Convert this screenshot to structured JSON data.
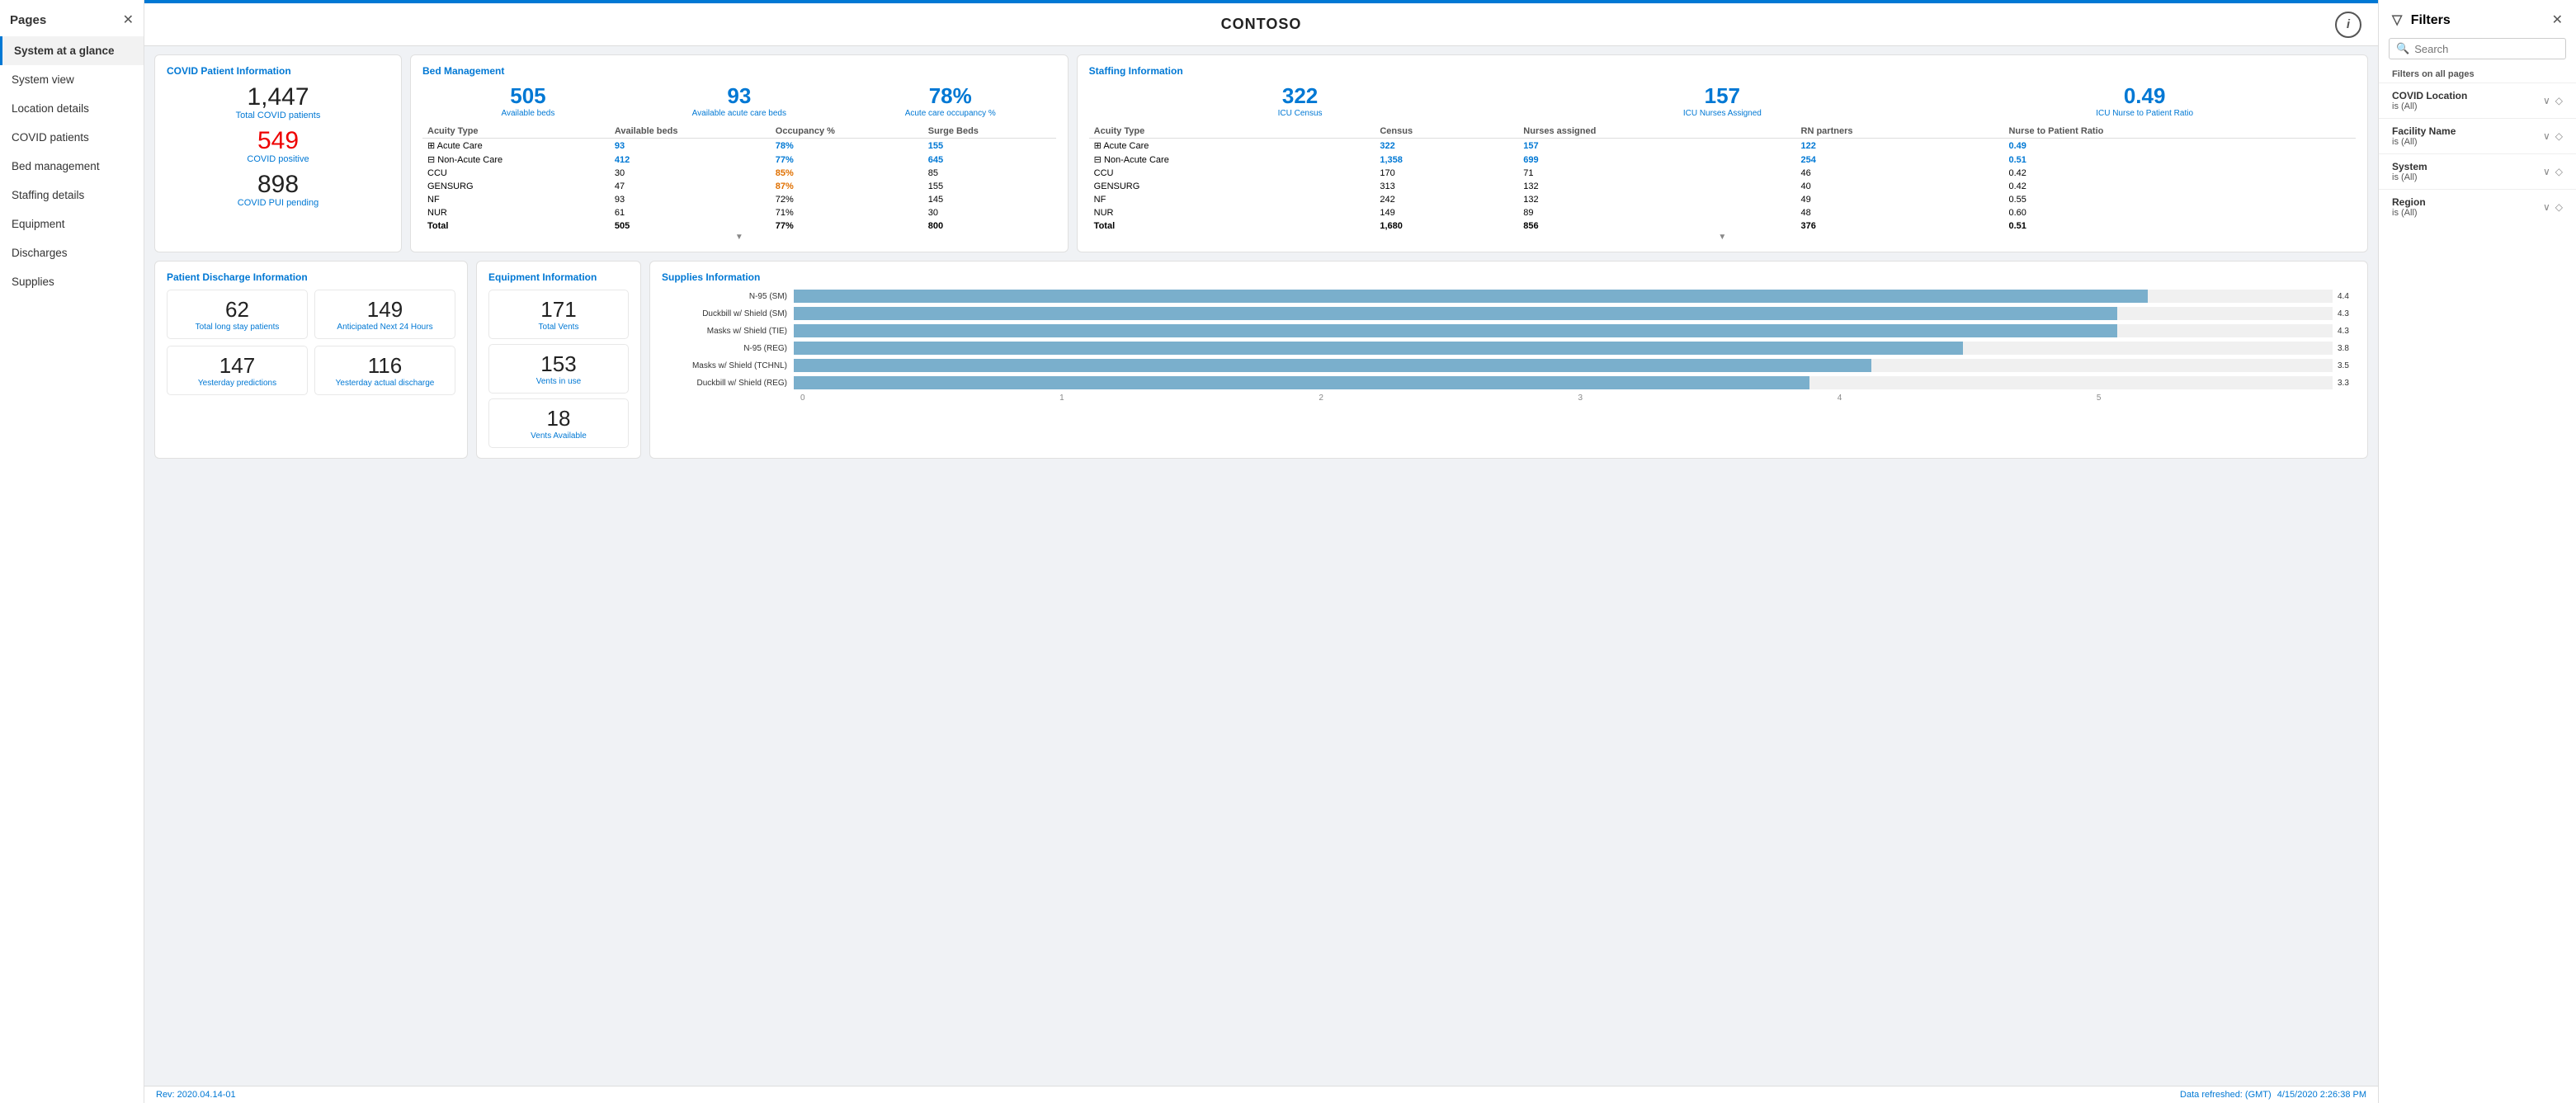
{
  "sidebar": {
    "header": "Pages",
    "items": [
      {
        "label": "System at a glance",
        "active": true
      },
      {
        "label": "System view"
      },
      {
        "label": "Location details"
      },
      {
        "label": "COVID patients"
      },
      {
        "label": "Bed management"
      },
      {
        "label": "Staffing details"
      },
      {
        "label": "Equipment"
      },
      {
        "label": "Discharges"
      },
      {
        "label": "Supplies"
      }
    ]
  },
  "header": {
    "title": "CONTOSO"
  },
  "covid_card": {
    "title": "COVID Patient Information",
    "stats": [
      {
        "num": "1,447",
        "label": "Total COVID patients",
        "red": false
      },
      {
        "num": "549",
        "label": "COVID positive",
        "red": true
      },
      {
        "num": "898",
        "label": "COVID PUI pending",
        "red": false
      }
    ]
  },
  "bed_card": {
    "title": "Bed Management",
    "top_stats": [
      {
        "num": "505",
        "label": "Available beds"
      },
      {
        "num": "93",
        "label": "Available acute care beds"
      },
      {
        "num": "78%",
        "label": "Acute care occupancy %"
      }
    ],
    "table": {
      "headers": [
        "Acuity Type",
        "Available beds",
        "Occupancy %",
        "Surge Beds"
      ],
      "rows": [
        {
          "type": "Acute Care",
          "available": "93",
          "occupancy": "78%",
          "surge": "155",
          "highlight": "blue",
          "expandable": true
        },
        {
          "type": "Non-Acute Care",
          "available": "412",
          "occupancy": "77%",
          "surge": "645",
          "highlight": "blue",
          "expandable": true
        },
        {
          "type": "CCU",
          "available": "30",
          "occupancy": "85%",
          "surge": "85",
          "highlight": "orange",
          "indent": true
        },
        {
          "type": "GENSURG",
          "available": "47",
          "occupancy": "87%",
          "surge": "155",
          "highlight": "orange",
          "indent": true
        },
        {
          "type": "NF",
          "available": "93",
          "occupancy": "72%",
          "surge": "145",
          "highlight": "none",
          "indent": true
        },
        {
          "type": "NUR",
          "available": "61",
          "occupancy": "71%",
          "surge": "30",
          "highlight": "none",
          "indent": true
        }
      ],
      "total": {
        "type": "Total",
        "available": "505",
        "occupancy": "77%",
        "surge": "800"
      }
    }
  },
  "staffing_card": {
    "title": "Staffing Information",
    "top_stats": [
      {
        "num": "322",
        "label": "ICU Census"
      },
      {
        "num": "157",
        "label": "ICU Nurses Assigned"
      },
      {
        "num": "0.49",
        "label": "ICU Nurse to Patient Ratio"
      }
    ],
    "table": {
      "headers": [
        "Acuity Type",
        "Census",
        "Nurses assigned",
        "RN partners",
        "Nurse to Patient Ratio"
      ],
      "rows": [
        {
          "type": "Acute Care",
          "census": "322",
          "nurses": "157",
          "rn": "122",
          "ratio": "0.49",
          "expandable": true,
          "highlight": true
        },
        {
          "type": "Non-Acute Care",
          "census": "1,358",
          "nurses": "699",
          "rn": "254",
          "ratio": "0.51",
          "expandable": true,
          "highlight": true
        },
        {
          "type": "CCU",
          "census": "170",
          "nurses": "71",
          "rn": "46",
          "ratio": "0.42",
          "indent": true
        },
        {
          "type": "GENSURG",
          "census": "313",
          "nurses": "132",
          "rn": "40",
          "ratio": "0.42",
          "indent": true
        },
        {
          "type": "NF",
          "census": "242",
          "nurses": "132",
          "rn": "49",
          "ratio": "0.55",
          "indent": true
        },
        {
          "type": "NUR",
          "census": "149",
          "nurses": "89",
          "rn": "48",
          "ratio": "0.60",
          "indent": true
        }
      ],
      "total": {
        "type": "Total",
        "census": "1,680",
        "nurses": "856",
        "rn": "376",
        "ratio": "0.51"
      }
    }
  },
  "discharge_card": {
    "title": "Patient Discharge Information",
    "stats": [
      {
        "num": "62",
        "label": "Total long stay patients"
      },
      {
        "num": "149",
        "label": "Anticipated Next 24 Hours"
      },
      {
        "num": "147",
        "label": "Yesterday predictions"
      },
      {
        "num": "116",
        "label": "Yesterday actual discharge"
      }
    ]
  },
  "equipment_card": {
    "title": "Equipment Information",
    "stats": [
      {
        "num": "171",
        "label": "Total Vents"
      },
      {
        "num": "153",
        "label": "Vents in use"
      },
      {
        "num": "18",
        "label": "Vents Available"
      }
    ]
  },
  "supplies_card": {
    "title": "Supplies Information",
    "bars": [
      {
        "label": "N-95 (SM)",
        "value": 4.4,
        "max": 5
      },
      {
        "label": "Duckbill w/ Shield (SM)",
        "value": 4.3,
        "max": 5
      },
      {
        "label": "Masks w/ Shield (TIE)",
        "value": 4.3,
        "max": 5
      },
      {
        "label": "N-95 (REG)",
        "value": 3.8,
        "max": 5
      },
      {
        "label": "Masks w/ Shield (TCHNL)",
        "value": 3.5,
        "max": 5
      },
      {
        "label": "Duckbill w/ Shield (REG)",
        "value": 3.3,
        "max": 5
      }
    ],
    "axis_labels": [
      "0",
      "1",
      "2",
      "3",
      "4",
      "5"
    ]
  },
  "footer": {
    "rev": "Rev: 2020.04.14-01",
    "refresh": "Data refreshed: (GMT)",
    "timestamp": "4/15/2020 2:26:38 PM"
  },
  "filters": {
    "title": "Filters",
    "search_placeholder": "Search",
    "section_label": "Filters on all pages",
    "items": [
      {
        "name": "COVID Location",
        "value": "is (All)"
      },
      {
        "name": "Facility Name",
        "value": "is (All)"
      },
      {
        "name": "System",
        "value": "is (All)"
      },
      {
        "name": "Region",
        "value": "is (All)"
      }
    ]
  }
}
